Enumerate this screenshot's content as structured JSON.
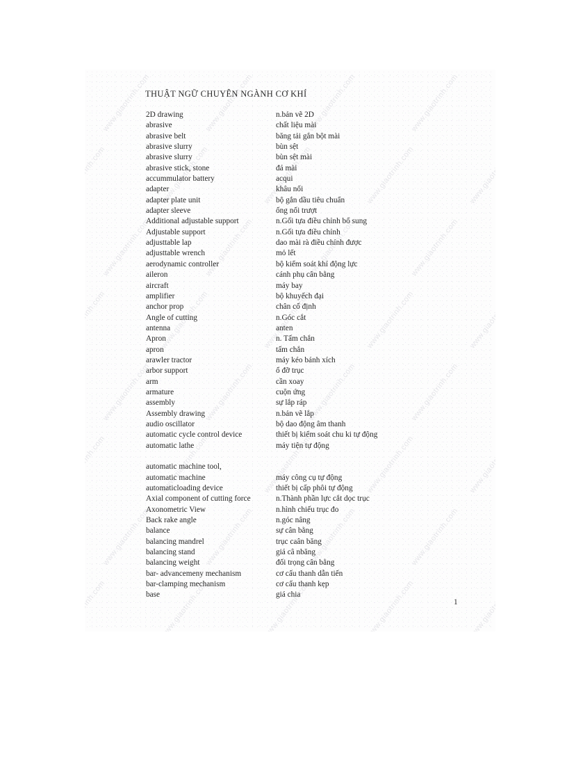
{
  "page": {
    "title": "THUẬT NGỮ CHUYÊN NGÀNH CƠ KHÍ",
    "page_number": "1",
    "watermark_text": "www.giaotrinh.com"
  },
  "glossary": {
    "entries": [
      {
        "term": "2D drawing",
        "meaning": "n.bản vẽ 2D"
      },
      {
        "term": "abrasive",
        "meaning": "chất liệu mài"
      },
      {
        "term": "abrasive belt",
        "meaning": "băng tải gắn bột mài"
      },
      {
        "term": "abrasive slurry",
        "meaning": "bùn sệt"
      },
      {
        "term": "abrasive slurry",
        "meaning": "bùn sệt mài"
      },
      {
        "term": "abrasive stick, stone",
        "meaning": "đá mài"
      },
      {
        "term": "accummulator battery",
        "meaning": "acqui"
      },
      {
        "term": "adapter",
        "meaning": "khâu nối"
      },
      {
        "term": "adapter plate unit",
        "meaning": "bộ gắn dầu tiêu chuẩn"
      },
      {
        "term": "adapter sleeve",
        "meaning": "ống nối trượt"
      },
      {
        "term": "Additional adjustable support",
        "meaning": "n.Gối tựa điều chỉnh bổ sung"
      },
      {
        "term": "Adjustable support",
        "meaning": "n.Gối tựa điều chỉnh"
      },
      {
        "term": "adjusttable lap",
        "meaning": "dao mài rà điều chỉnh được"
      },
      {
        "term": "adjusttable wrench",
        "meaning": "mỏ lết"
      },
      {
        "term": "aerodynamic controller",
        "meaning": "bộ kiểm soát khí động lực"
      },
      {
        "term": "aileron",
        "meaning": "cánh phụ cân bằng"
      },
      {
        "term": "aircraft",
        "meaning": "máy bay"
      },
      {
        "term": "amplifier",
        "meaning": "bộ khuyếch đại"
      },
      {
        "term": "anchor prop",
        "meaning": "chân cố định"
      },
      {
        "term": "Angle of cutting",
        "meaning": "n.Góc cắt"
      },
      {
        "term": "antenna",
        "meaning": "anten"
      },
      {
        "term": "Apron",
        "meaning": "n. Tấm chắn"
      },
      {
        "term": "apron",
        "meaning": "tấm chắn"
      },
      {
        "term": "arawler tractor",
        "meaning": "máy kéo bánh xích"
      },
      {
        "term": "arbor support",
        "meaning": "ổ đỡ trục"
      },
      {
        "term": "arm",
        "meaning": "cần xoay"
      },
      {
        "term": "armature",
        "meaning": "cuộn ứng"
      },
      {
        "term": "assembly",
        "meaning": "sự lắp ráp"
      },
      {
        "term": "Assembly drawing",
        "meaning": "n.bản vẽ lắp"
      },
      {
        "term": "audio oscillator",
        "meaning": "bộ dao động âm thanh"
      },
      {
        "term": "automatic cycle control device",
        "meaning": "thiết bị kiểm soát chu ki tự động"
      },
      {
        "term": "automatic lathe",
        "meaning": "máy tiện tự động"
      },
      {
        "term": "automatic machine tool,",
        "meaning": ""
      },
      {
        "term": "automatic machine",
        "meaning": "máy công cụ tự động"
      },
      {
        "term": "automaticloading device",
        "meaning": "thiết bị cấp phôi tự động"
      },
      {
        "term": "Axial component of cutting force",
        "meaning": "n.Thành phần lực cắt dọc trục"
      },
      {
        "term": "Axonometric View",
        "meaning": "n.hình chiếu trục đo"
      },
      {
        "term": "Back rake angle",
        "meaning": "n.góc nâng"
      },
      {
        "term": "balance",
        "meaning": "sự cân bằng"
      },
      {
        "term": "balancing mandrel",
        "meaning": "trục caân băng"
      },
      {
        "term": "balancing stand",
        "meaning": "giá câ nbăng"
      },
      {
        "term": "balancing weight",
        "meaning": "đối trọng cân bằng"
      },
      {
        "term": "bar- advancemeny mechanism",
        "meaning": "cơ cấu thanh dẫn tiến"
      },
      {
        "term": "bar-clamping mechanism",
        "meaning": "cơ cấu thanh kẹp"
      },
      {
        "term": "base",
        "meaning": "giá chia"
      }
    ]
  }
}
